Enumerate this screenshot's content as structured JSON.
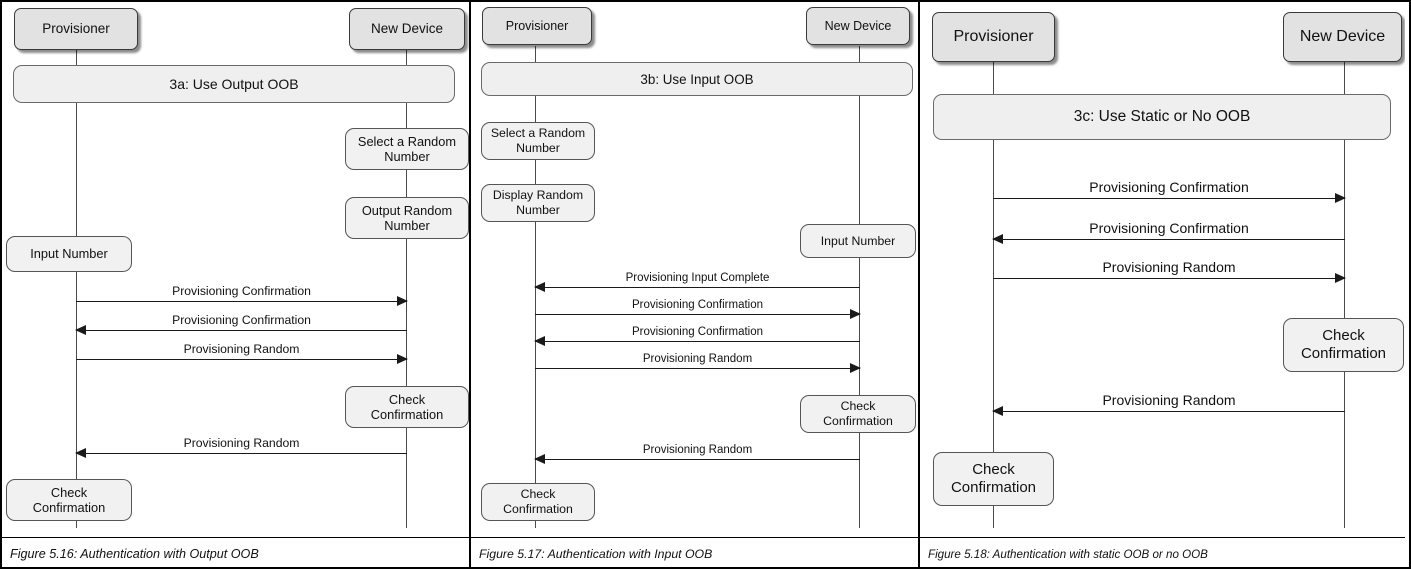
{
  "panels": [
    {
      "id": "panel-1",
      "caption": "Figure 5.16: Authentication with Output OOB",
      "frame_label": "3a:  Use Output OOB",
      "actors": [
        {
          "label": "Provisioner"
        },
        {
          "label": "New Device"
        }
      ],
      "actions": [
        {
          "label": "Select a Random\nNumber",
          "lane": "right"
        },
        {
          "label": "Output Random\nNumber",
          "lane": "right"
        },
        {
          "label": "Input Number",
          "lane": "left"
        },
        {
          "label": "Check\nConfirmation",
          "lane": "right"
        },
        {
          "label": "Check\nConfirmation",
          "lane": "left"
        }
      ],
      "messages": [
        {
          "label": "Provisioning Confirmation",
          "direction": "to-right"
        },
        {
          "label": "Provisioning Confirmation",
          "direction": "to-left"
        },
        {
          "label": "Provisioning Random",
          "direction": "to-right"
        },
        {
          "label": "Provisioning Random",
          "direction": "to-left"
        }
      ]
    },
    {
      "id": "panel-2",
      "caption": "Figure 5.17: Authentication with Input OOB",
      "frame_label": "3b:  Use Input OOB",
      "actors": [
        {
          "label": "Provisioner"
        },
        {
          "label": "New Device"
        }
      ],
      "actions": [
        {
          "label": "Select a Random\nNumber",
          "lane": "left"
        },
        {
          "label": "Display Random\nNumber",
          "lane": "left"
        },
        {
          "label": "Input Number",
          "lane": "right"
        },
        {
          "label": "Check\nConfirmation",
          "lane": "right"
        },
        {
          "label": "Check\nConfirmation",
          "lane": "left"
        }
      ],
      "messages": [
        {
          "label": "Provisioning Input Complete",
          "direction": "to-left"
        },
        {
          "label": "Provisioning Confirmation",
          "direction": "to-right"
        },
        {
          "label": "Provisioning Confirmation",
          "direction": "to-left"
        },
        {
          "label": "Provisioning Random",
          "direction": "to-right"
        },
        {
          "label": "Provisioning Random",
          "direction": "to-left"
        }
      ]
    },
    {
      "id": "panel-3",
      "caption": "Figure 5.18: Authentication with static OOB or no OOB",
      "frame_label": "3c:  Use Static or No OOB",
      "actors": [
        {
          "label": "Provisioner"
        },
        {
          "label": "New Device"
        }
      ],
      "actions": [
        {
          "label": "Check\nConfirmation",
          "lane": "right"
        },
        {
          "label": "Check\nConfirmation",
          "lane": "left"
        }
      ],
      "messages": [
        {
          "label": "Provisioning Confirmation",
          "direction": "to-right"
        },
        {
          "label": "Provisioning Confirmation",
          "direction": "to-left"
        },
        {
          "label": "Provisioning Random",
          "direction": "to-right"
        },
        {
          "label": "Provisioning Random",
          "direction": "to-left"
        }
      ]
    }
  ],
  "colors": {
    "actor_fill": "#e2e2e2",
    "frame_fill": "#efefef",
    "action_fill": "#f1f1f1",
    "border": "#3a3a3a",
    "line": "#1a1a1a",
    "lifeline": "#4a4a4a",
    "background": "#ffffff"
  }
}
